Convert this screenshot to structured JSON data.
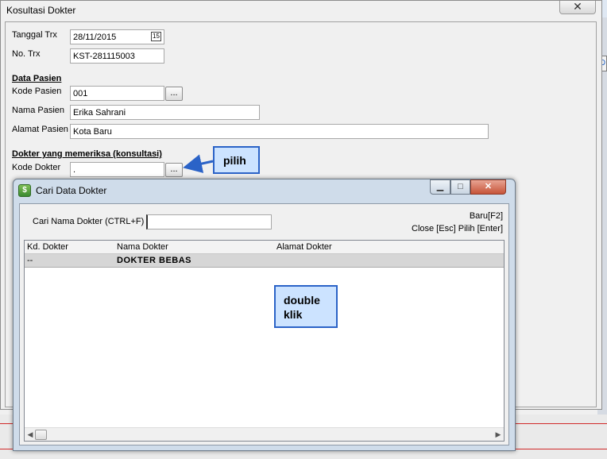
{
  "main_dialog": {
    "title": "Kosultasi Dokter",
    "close_glyph": "✕",
    "tanggal_label": "Tanggal Trx",
    "tanggal_value": "28/11/2015",
    "calendar_glyph": "15",
    "no_trx_label": "No. Trx",
    "no_trx_value": "KST-281115003",
    "data_pasien_header": "Data Pasien",
    "kode_pasien_label": "Kode Pasien",
    "kode_pasien_value": "001",
    "nama_pasien_label": "Nama Pasien",
    "nama_pasien_value": "Erika Sahrani",
    "alamat_pasien_label": "Alamat Pasien",
    "alamat_pasien_value": "Kota Baru",
    "dokter_header": "Dokter yang memeriksa (konsultasi)",
    "kode_dokter_label": "Kode Dokter",
    "kode_dokter_value": ".",
    "browse_label": "..."
  },
  "callouts": {
    "pilih": "pilih",
    "double_line1": "double",
    "double_line2": "klik",
    "accent": "#2b63c7",
    "fill": "#cce3ff"
  },
  "cari_dialog": {
    "title": "Cari Data Dokter",
    "icon_glyph": "$",
    "min_glyph": "▁",
    "max_glyph": "□",
    "close_glyph": "✕",
    "search_label": "Cari Nama Dokter (CTRL+F)",
    "search_value": "",
    "hint_baru": "Baru[F2]",
    "hint_close": "Close [Esc]",
    "hint_pilih": "Pilih [Enter]",
    "columns": [
      "Kd. Dokter",
      "Nama Dokter",
      "Alamat Dokter"
    ],
    "rows": [
      {
        "kode": "--",
        "nama": "DOKTER BEBAS",
        "alamat": ""
      }
    ],
    "scroll_left": "◀",
    "scroll_right": "▶"
  }
}
